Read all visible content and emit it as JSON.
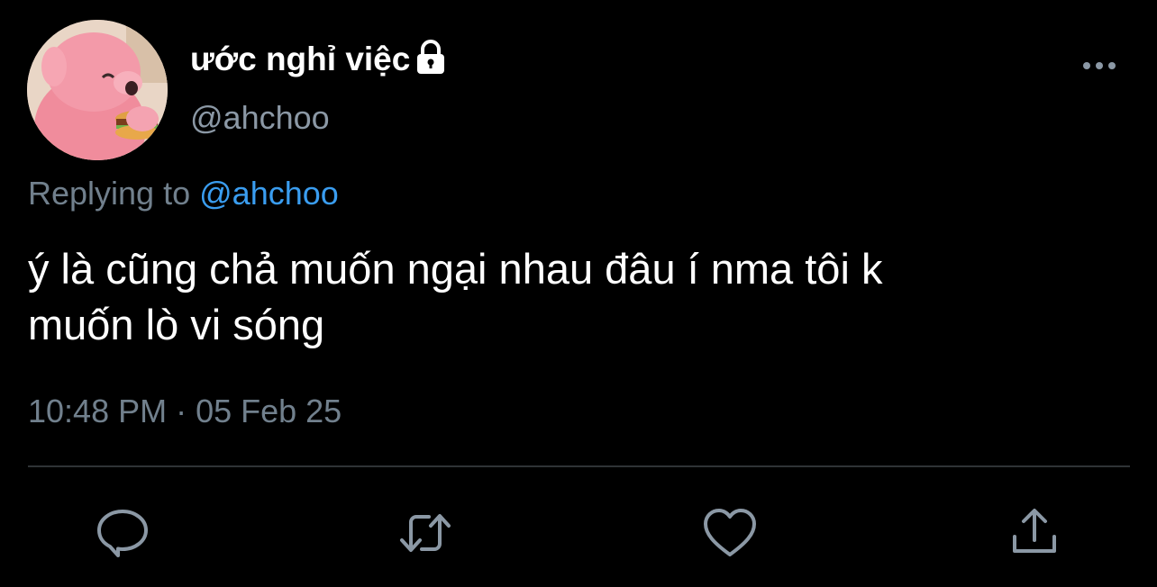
{
  "user": {
    "display_name": "ước nghỉ việc",
    "handle": "@ahchoo",
    "avatar_icon": "avatar-pink-bear-eating-burger",
    "protected_icon": "lock-icon"
  },
  "reply": {
    "prefix": "Replying to",
    "handle": "@ahchoo"
  },
  "tweet": {
    "line1": "ý là cũng chả muốn ngại nhau đâu í nma tôi k",
    "line2": "muốn lò vi sóng",
    "timestamp": "10:48 PM · 05 Feb 25"
  },
  "actions": {
    "reply_icon": "reply-icon",
    "retweet_icon": "retweet-icon",
    "like_icon": "like-icon",
    "share_icon": "share-icon",
    "more_icon": "more-icon"
  },
  "colors": {
    "background": "#000000",
    "text_primary": "#ffffff",
    "text_secondary": "#71808d",
    "link": "#3a9df0",
    "icon": "#8b98a5",
    "divider": "#2f3336"
  }
}
